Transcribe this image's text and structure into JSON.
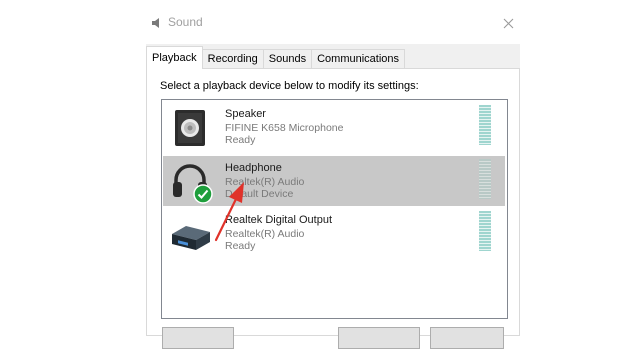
{
  "window": {
    "title": "Sound",
    "icons": {
      "title": "speaker-icon",
      "close": "close-icon"
    }
  },
  "tabs": [
    {
      "label": "Playback",
      "active": true
    },
    {
      "label": "Recording",
      "active": false
    },
    {
      "label": "Sounds",
      "active": false
    },
    {
      "label": "Communications",
      "active": false
    }
  ],
  "instruction": "Select a playback device below to modify its settings:",
  "devices": [
    {
      "name": "Speaker",
      "description": "FIFINE K658 Microphone",
      "status": "Ready",
      "icon": "speaker-device-icon",
      "selected": false
    },
    {
      "name": "Headphone",
      "description": "Realtek(R) Audio",
      "status": "Default Device",
      "icon": "headphone-device-icon",
      "selected": true,
      "default": true
    },
    {
      "name": "Realtek Digital Output",
      "description": "Realtek(R) Audio",
      "status": "Ready",
      "icon": "digital-output-device-icon",
      "selected": false
    }
  ],
  "colors": {
    "selected_row": "#c8c8c8",
    "default_check": "#1e9e3c",
    "annotation_arrow": "#e0322a"
  }
}
